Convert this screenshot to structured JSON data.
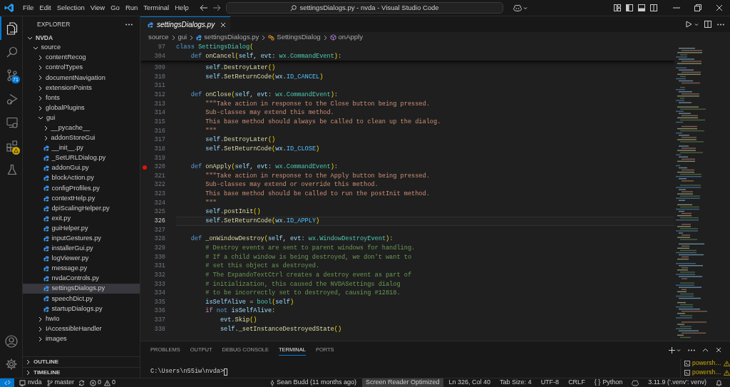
{
  "window": {
    "title": "settingsDialogs.py - nvda - Visual Studio Code"
  },
  "menu": [
    "File",
    "Edit",
    "Selection",
    "View",
    "Go",
    "Run",
    "Terminal",
    "Help"
  ],
  "activity_bar": {
    "items": [
      {
        "kind": "explorer",
        "selected": true
      },
      {
        "kind": "search",
        "selected": false
      },
      {
        "kind": "source-control",
        "selected": false,
        "badge": "71"
      },
      {
        "kind": "run",
        "selected": false
      },
      {
        "kind": "remote",
        "selected": false
      },
      {
        "kind": "extensions",
        "selected": false,
        "warning": true
      },
      {
        "kind": "testing",
        "selected": false
      }
    ],
    "bottom": [
      {
        "kind": "account"
      },
      {
        "kind": "settings"
      }
    ]
  },
  "explorer": {
    "title": "EXPLORER",
    "tree": [
      {
        "label": "NVDA",
        "kind": "root",
        "expanded": true,
        "selected": false,
        "children": [
          {
            "label": "source",
            "kind": "folder",
            "expanded": true,
            "selected": false,
            "children": [
              {
                "label": "contentRecog",
                "kind": "folder",
                "expanded": false,
                "selected": false
              },
              {
                "label": "controlTypes",
                "kind": "folder",
                "expanded": false,
                "selected": false
              },
              {
                "label": "documentNavigation",
                "kind": "folder",
                "expanded": false,
                "selected": false
              },
              {
                "label": "extensionPoints",
                "kind": "folder",
                "expanded": false,
                "selected": false
              },
              {
                "label": "fonts",
                "kind": "folder",
                "expanded": false,
                "selected": false
              },
              {
                "label": "globalPlugins",
                "kind": "folder",
                "expanded": false,
                "selected": false
              },
              {
                "label": "gui",
                "kind": "folder",
                "expanded": true,
                "selected": false,
                "children": [
                  {
                    "label": "__pycache__",
                    "kind": "folder",
                    "expanded": false,
                    "selected": false
                  },
                  {
                    "label": "addonStoreGui",
                    "kind": "folder",
                    "expanded": false,
                    "selected": false
                  },
                  {
                    "label": "__init__.py",
                    "kind": "python",
                    "selected": false
                  },
                  {
                    "label": "_SetURLDialog.py",
                    "kind": "python",
                    "selected": false
                  },
                  {
                    "label": "addonGui.py",
                    "kind": "python",
                    "selected": false
                  },
                  {
                    "label": "blockAction.py",
                    "kind": "python",
                    "selected": false
                  },
                  {
                    "label": "configProfiles.py",
                    "kind": "python",
                    "selected": false
                  },
                  {
                    "label": "contextHelp.py",
                    "kind": "python",
                    "selected": false
                  },
                  {
                    "label": "dpiScalingHelper.py",
                    "kind": "python",
                    "selected": false
                  },
                  {
                    "label": "exit.py",
                    "kind": "python",
                    "selected": false
                  },
                  {
                    "label": "guiHelper.py",
                    "kind": "python",
                    "selected": false
                  },
                  {
                    "label": "inputGestures.py",
                    "kind": "python",
                    "selected": false
                  },
                  {
                    "label": "installerGui.py",
                    "kind": "python",
                    "selected": false
                  },
                  {
                    "label": "logViewer.py",
                    "kind": "python",
                    "selected": false
                  },
                  {
                    "label": "message.py",
                    "kind": "python",
                    "selected": false
                  },
                  {
                    "label": "nvdaControls.py",
                    "kind": "python",
                    "selected": false
                  },
                  {
                    "label": "settingsDialogs.py",
                    "kind": "python",
                    "selected": true
                  },
                  {
                    "label": "speechDict.py",
                    "kind": "python",
                    "selected": false
                  },
                  {
                    "label": "startupDialogs.py",
                    "kind": "python",
                    "selected": false
                  }
                ]
              },
              {
                "label": "hwIo",
                "kind": "folder",
                "expanded": false,
                "selected": false
              },
              {
                "label": "IAccessibleHandler",
                "kind": "folder",
                "expanded": false,
                "selected": false
              },
              {
                "label": "images",
                "kind": "folder",
                "expanded": false,
                "selected": false
              }
            ]
          }
        ]
      }
    ],
    "sections": [
      {
        "label": "OUTLINE",
        "expanded": false
      },
      {
        "label": "TIMELINE",
        "expanded": false
      }
    ]
  },
  "editor": {
    "tabs": [
      {
        "label": "settingsDialogs.py",
        "selected": true,
        "preview": true
      }
    ],
    "breadcrumb": [
      {
        "label": "source",
        "kind": "folder"
      },
      {
        "label": "gui",
        "kind": "folder"
      },
      {
        "label": "settingsDialogs.py",
        "kind": "python"
      },
      {
        "label": "SettingsDialog",
        "kind": "class"
      },
      {
        "label": "onApply",
        "kind": "method"
      }
    ],
    "sticky_lines": [
      {
        "number": "97",
        "segments": [
          {
            "text": "class ",
            "kind": "keyword"
          },
          {
            "text": "SettingsDialog",
            "kind": "class"
          },
          {
            "text": "(",
            "kind": "bracket"
          }
        ]
      },
      {
        "number": "304",
        "segments": [
          {
            "text": "    def ",
            "kind": "keyword"
          },
          {
            "text": "onCancel",
            "kind": "function"
          },
          {
            "text": "(",
            "kind": "bracket"
          },
          {
            "text": "self",
            "kind": "variable"
          },
          {
            "text": ", ",
            "kind": "plain"
          },
          {
            "text": "evt",
            "kind": "variable"
          },
          {
            "text": ": ",
            "kind": "plain"
          },
          {
            "text": "wx.CommandEvent",
            "kind": "class"
          },
          {
            "text": ")",
            "kind": "bracket"
          },
          {
            "text": ":",
            "kind": "plain"
          }
        ]
      }
    ],
    "lines": [
      {
        "number": "309",
        "breakpoint": false,
        "current": false,
        "segments": [
          {
            "text": "        self",
            "kind": "variable"
          },
          {
            "text": ".",
            "kind": "plain"
          },
          {
            "text": "DestroyLater",
            "kind": "function"
          },
          {
            "text": "()",
            "kind": "bracket"
          }
        ]
      },
      {
        "number": "310",
        "breakpoint": false,
        "current": false,
        "segments": [
          {
            "text": "        self",
            "kind": "variable"
          },
          {
            "text": ".",
            "kind": "plain"
          },
          {
            "text": "SetReturnCode",
            "kind": "function"
          },
          {
            "text": "(",
            "kind": "bracket"
          },
          {
            "text": "wx",
            "kind": "variable"
          },
          {
            "text": ".",
            "kind": "plain"
          },
          {
            "text": "ID_CANCEL",
            "kind": "constant"
          },
          {
            "text": ")",
            "kind": "bracket"
          }
        ]
      },
      {
        "number": "311",
        "breakpoint": false,
        "current": false
      },
      {
        "number": "312",
        "breakpoint": false,
        "current": false,
        "segments": [
          {
            "text": "    def ",
            "kind": "keyword"
          },
          {
            "text": "onClose",
            "kind": "function"
          },
          {
            "text": "(",
            "kind": "bracket"
          },
          {
            "text": "self",
            "kind": "variable"
          },
          {
            "text": ", ",
            "kind": "plain"
          },
          {
            "text": "evt",
            "kind": "variable"
          },
          {
            "text": ": ",
            "kind": "plain"
          },
          {
            "text": "wx.CommandEvent",
            "kind": "class"
          },
          {
            "text": ")",
            "kind": "bracket"
          },
          {
            "text": ":",
            "kind": "plain"
          }
        ]
      },
      {
        "number": "313",
        "breakpoint": false,
        "current": false,
        "segments": [
          {
            "text": "        \"\"\"Take action in response to the Close button being pressed.",
            "kind": "string"
          }
        ]
      },
      {
        "number": "314",
        "breakpoint": false,
        "current": false,
        "segments": [
          {
            "text": "        Sub-classes may extend this method.",
            "kind": "string"
          }
        ]
      },
      {
        "number": "315",
        "breakpoint": false,
        "current": false,
        "segments": [
          {
            "text": "        This base method should always be called to clean up the dialog.",
            "kind": "string"
          }
        ]
      },
      {
        "number": "316",
        "breakpoint": false,
        "current": false,
        "segments": [
          {
            "text": "        \"\"\"",
            "kind": "string"
          }
        ]
      },
      {
        "number": "317",
        "breakpoint": false,
        "current": false,
        "segments": [
          {
            "text": "        self",
            "kind": "variable"
          },
          {
            "text": ".",
            "kind": "plain"
          },
          {
            "text": "DestroyLater",
            "kind": "function"
          },
          {
            "text": "()",
            "kind": "bracket"
          }
        ]
      },
      {
        "number": "318",
        "breakpoint": false,
        "current": false,
        "segments": [
          {
            "text": "        self",
            "kind": "variable"
          },
          {
            "text": ".",
            "kind": "plain"
          },
          {
            "text": "SetReturnCode",
            "kind": "function"
          },
          {
            "text": "(",
            "kind": "bracket"
          },
          {
            "text": "wx",
            "kind": "variable"
          },
          {
            "text": ".",
            "kind": "plain"
          },
          {
            "text": "ID_CLOSE",
            "kind": "constant"
          },
          {
            "text": ")",
            "kind": "bracket"
          }
        ]
      },
      {
        "number": "319",
        "breakpoint": false,
        "current": false
      },
      {
        "number": "320",
        "breakpoint": true,
        "current": false,
        "segments": [
          {
            "text": "    def ",
            "kind": "keyword"
          },
          {
            "text": "onApply",
            "kind": "function"
          },
          {
            "text": "(",
            "kind": "bracket"
          },
          {
            "text": "self",
            "kind": "variable"
          },
          {
            "text": ", ",
            "kind": "plain"
          },
          {
            "text": "evt",
            "kind": "variable"
          },
          {
            "text": ": ",
            "kind": "plain"
          },
          {
            "text": "wx.CommandEvent",
            "kind": "class"
          },
          {
            "text": ")",
            "kind": "bracket"
          },
          {
            "text": ":",
            "kind": "plain"
          }
        ]
      },
      {
        "number": "321",
        "breakpoint": false,
        "current": false,
        "segments": [
          {
            "text": "        \"\"\"Take action in response to the Apply button being pressed.",
            "kind": "string"
          }
        ]
      },
      {
        "number": "322",
        "breakpoint": false,
        "current": false,
        "segments": [
          {
            "text": "        Sub-classes may extend or override this method.",
            "kind": "string"
          }
        ]
      },
      {
        "number": "323",
        "breakpoint": false,
        "current": false,
        "segments": [
          {
            "text": "        This base method should be called to run the postInit method.",
            "kind": "string"
          }
        ]
      },
      {
        "number": "324",
        "breakpoint": false,
        "current": false,
        "segments": [
          {
            "text": "        \"\"\"",
            "kind": "string"
          }
        ]
      },
      {
        "number": "325",
        "breakpoint": false,
        "current": false,
        "segments": [
          {
            "text": "        self",
            "kind": "variable"
          },
          {
            "text": ".",
            "kind": "plain"
          },
          {
            "text": "postInit",
            "kind": "function"
          },
          {
            "text": "()",
            "kind": "bracket"
          }
        ]
      },
      {
        "number": "326",
        "breakpoint": false,
        "current": true,
        "segments": [
          {
            "text": "        self",
            "kind": "variable"
          },
          {
            "text": ".",
            "kind": "plain"
          },
          {
            "text": "SetReturnCode",
            "kind": "function"
          },
          {
            "text": "(",
            "kind": "bracket"
          },
          {
            "text": "wx",
            "kind": "variable"
          },
          {
            "text": ".",
            "kind": "plain"
          },
          {
            "text": "ID_APPLY",
            "kind": "constant"
          },
          {
            "text": ")",
            "kind": "bracket"
          }
        ]
      },
      {
        "number": "327",
        "breakpoint": false,
        "current": false
      },
      {
        "number": "328",
        "breakpoint": false,
        "current": false,
        "segments": [
          {
            "text": "    def ",
            "kind": "keyword"
          },
          {
            "text": "_onWindowDestroy",
            "kind": "function"
          },
          {
            "text": "(",
            "kind": "bracket"
          },
          {
            "text": "self",
            "kind": "variable"
          },
          {
            "text": ", ",
            "kind": "plain"
          },
          {
            "text": "evt",
            "kind": "variable"
          },
          {
            "text": ": ",
            "kind": "plain"
          },
          {
            "text": "wx.WindowDestroyEvent",
            "kind": "class"
          },
          {
            "text": ")",
            "kind": "bracket"
          },
          {
            "text": ":",
            "kind": "plain"
          }
        ]
      },
      {
        "number": "329",
        "breakpoint": false,
        "current": false,
        "segments": [
          {
            "text": "        # Destroy events are sent to parent windows for handling.",
            "kind": "comment"
          }
        ]
      },
      {
        "number": "330",
        "breakpoint": false,
        "current": false,
        "segments": [
          {
            "text": "        # If a child window is being destroyed, we don't want to",
            "kind": "comment"
          }
        ]
      },
      {
        "number": "331",
        "breakpoint": false,
        "current": false,
        "segments": [
          {
            "text": "        # set this object as destroyed.",
            "kind": "comment"
          }
        ]
      },
      {
        "number": "332",
        "breakpoint": false,
        "current": false,
        "segments": [
          {
            "text": "        # The ExpandoTextCtrl creates a destroy event as part of",
            "kind": "comment"
          }
        ]
      },
      {
        "number": "333",
        "breakpoint": false,
        "current": false,
        "segments": [
          {
            "text": "        # initialization, this caused the NVDASettings dialog",
            "kind": "comment"
          }
        ]
      },
      {
        "number": "334",
        "breakpoint": false,
        "current": false,
        "segments": [
          {
            "text": "        # to be incorrectly set to destroyed, causing #12818.",
            "kind": "comment"
          }
        ]
      },
      {
        "number": "335",
        "breakpoint": false,
        "current": false,
        "segments": [
          {
            "text": "        isSelfAlive",
            "kind": "variable"
          },
          {
            "text": " = ",
            "kind": "plain"
          },
          {
            "text": "bool",
            "kind": "class"
          },
          {
            "text": "(",
            "kind": "bracket"
          },
          {
            "text": "self",
            "kind": "variable"
          },
          {
            "text": ")",
            "kind": "bracket"
          }
        ]
      },
      {
        "number": "336",
        "breakpoint": false,
        "current": false,
        "segments": [
          {
            "text": "        if",
            "kind": "control"
          },
          {
            "text": " not",
            "kind": "keyword"
          },
          {
            "text": " isSelfAlive",
            "kind": "variable"
          },
          {
            "text": ":",
            "kind": "plain"
          }
        ]
      },
      {
        "number": "337",
        "breakpoint": false,
        "current": false,
        "segments": [
          {
            "text": "            evt",
            "kind": "variable"
          },
          {
            "text": ".",
            "kind": "plain"
          },
          {
            "text": "Skip",
            "kind": "function"
          },
          {
            "text": "()",
            "kind": "bracket"
          }
        ]
      },
      {
        "number": "338",
        "breakpoint": false,
        "current": false,
        "segments": [
          {
            "text": "            self",
            "kind": "variable"
          },
          {
            "text": ".",
            "kind": "plain"
          },
          {
            "text": "_setInstanceDestroyedState",
            "kind": "function"
          },
          {
            "text": "()",
            "kind": "bracket"
          }
        ]
      }
    ]
  },
  "panel": {
    "tabs": [
      {
        "label": "PROBLEMS",
        "selected": false
      },
      {
        "label": "OUTPUT",
        "selected": false
      },
      {
        "label": "DEBUG CONSOLE",
        "selected": false
      },
      {
        "label": "TERMINAL",
        "selected": true
      },
      {
        "label": "PORTS",
        "selected": false
      }
    ],
    "terminal": {
      "prompt": "C:\\Users\\n55iw\\nvda>"
    },
    "sessions": [
      {
        "label": "powersh…",
        "warning": true
      },
      {
        "label": "powersh…",
        "warning": true
      }
    ]
  },
  "status_bar": {
    "left": [
      {
        "kind": "remote"
      },
      {
        "kind": "folder",
        "label": "nvda"
      },
      {
        "kind": "branch",
        "label": "master"
      },
      {
        "kind": "sync"
      },
      {
        "kind": "problems",
        "errors": "0",
        "warnings": "0"
      }
    ],
    "right": [
      {
        "kind": "blame",
        "label": "Sean Budd (11 months ago)",
        "highlighted": false
      },
      {
        "kind": "text",
        "label": "Screen Reader Optimized",
        "highlighted": true
      },
      {
        "kind": "text",
        "label": "Ln 326, Col 40",
        "highlighted": false
      },
      {
        "kind": "text",
        "label": "Tab Size: 4",
        "highlighted": false
      },
      {
        "kind": "text",
        "label": "UTF-8",
        "highlighted": false
      },
      {
        "kind": "text",
        "label": "CRLF",
        "highlighted": false
      },
      {
        "kind": "language",
        "icon": "{ }",
        "label": "Python",
        "highlighted": false
      },
      {
        "kind": "copilot",
        "highlighted": false
      },
      {
        "kind": "text",
        "label": "3.11.9 ('.venv': venv)",
        "highlighted": false
      },
      {
        "kind": "bell",
        "highlighted": false
      }
    ]
  }
}
